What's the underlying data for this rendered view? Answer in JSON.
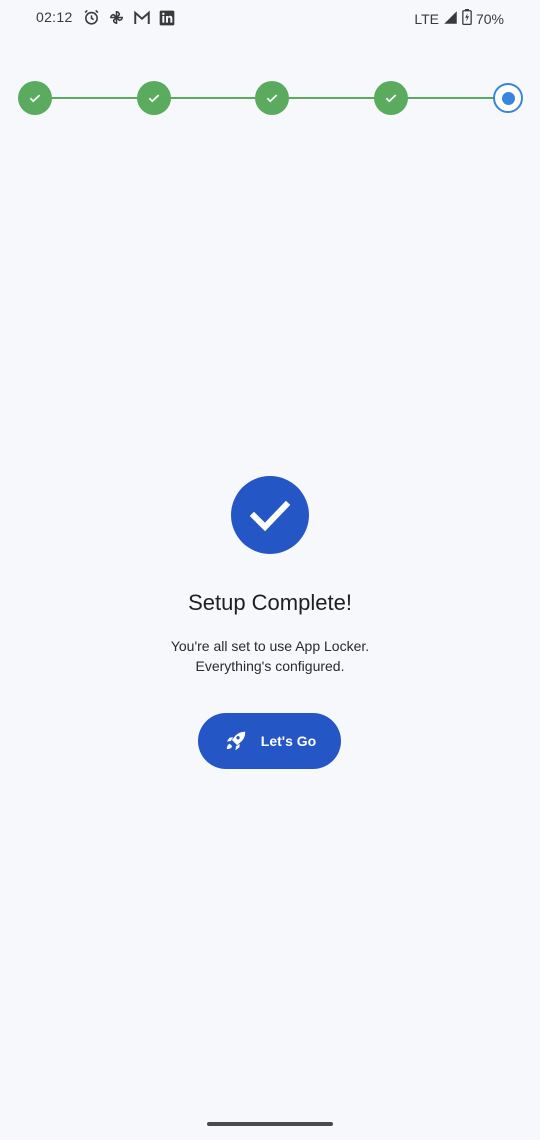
{
  "status_bar": {
    "time": "02:12",
    "network": "LTE",
    "battery": "70%",
    "notification_icons": [
      "alarm-icon",
      "pinwheel-icon",
      "gmail-icon",
      "linkedin-icon"
    ]
  },
  "stepper": {
    "total_steps": 5,
    "completed_steps": 4,
    "current_step": 5,
    "done_color": "#5aab5e",
    "current_color": "#3a84e0"
  },
  "main": {
    "title": "Setup Complete!",
    "subtitle_line1": "You're all set to use App Locker.",
    "subtitle_line2": "Everything's configured.",
    "button_label": "Let's Go",
    "button_icon": "rocket-icon",
    "success_icon": "checkmark-icon",
    "accent_color": "#2457c5"
  }
}
